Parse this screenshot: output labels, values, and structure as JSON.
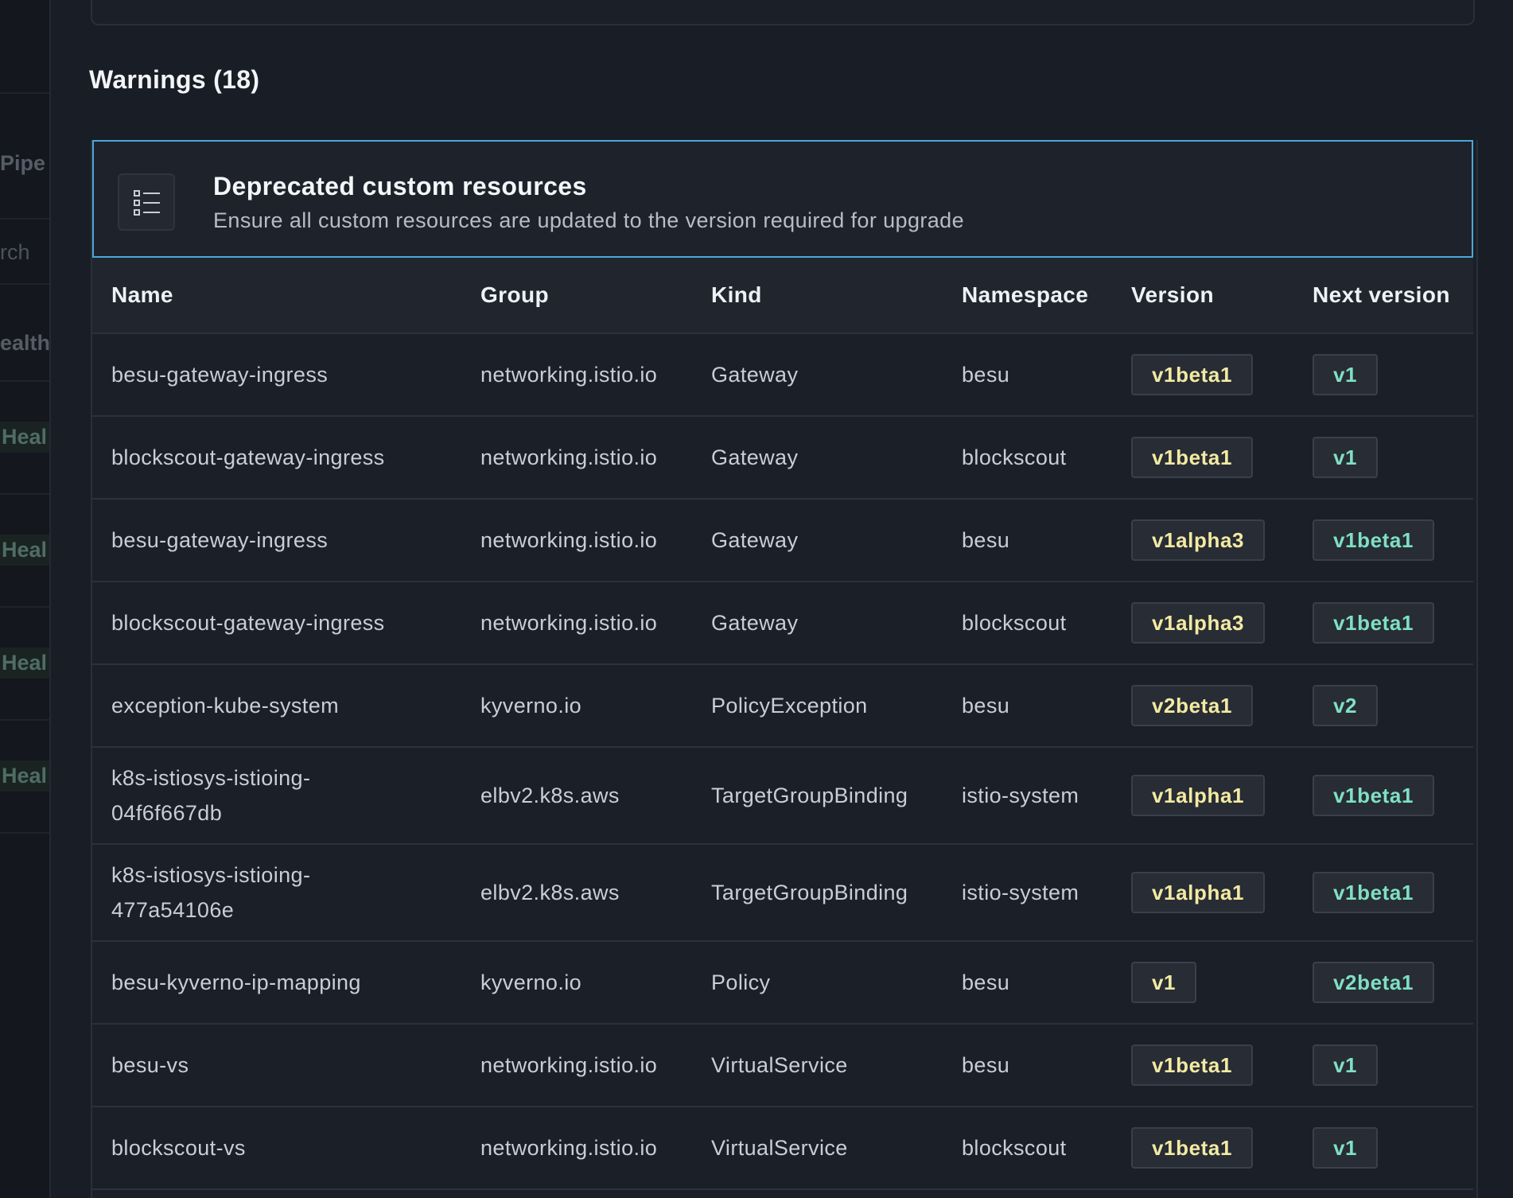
{
  "sidebar": {
    "items": [
      {
        "label": "Pipe",
        "kind": "bold"
      },
      {
        "label": "rch",
        "kind": "plain"
      },
      {
        "label": "ealth",
        "kind": "bold"
      },
      {
        "label": "Heal",
        "kind": "health"
      },
      {
        "label": "Heal",
        "kind": "health"
      },
      {
        "label": "Heal",
        "kind": "health"
      },
      {
        "label": "Heal",
        "kind": "health"
      }
    ]
  },
  "section": {
    "title": "Warnings (18)"
  },
  "card": {
    "icon": "list-icon",
    "title": "Deprecated custom resources",
    "subtitle": "Ensure all custom resources are updated to the version required for upgrade",
    "collapse_icon": "chevron-up-icon"
  },
  "table": {
    "headers": {
      "name": "Name",
      "group": "Group",
      "kind": "Kind",
      "namespace": "Namespace",
      "version": "Version",
      "next_version": "Next version"
    },
    "rows": [
      {
        "name": "besu-gateway-ingress",
        "group": "networking.istio.io",
        "kind": "Gateway",
        "namespace": "besu",
        "version": "v1beta1",
        "next_version": "v1"
      },
      {
        "name": "blockscout-gateway-ingress",
        "group": "networking.istio.io",
        "kind": "Gateway",
        "namespace": "blockscout",
        "version": "v1beta1",
        "next_version": "v1"
      },
      {
        "name": "besu-gateway-ingress",
        "group": "networking.istio.io",
        "kind": "Gateway",
        "namespace": "besu",
        "version": "v1alpha3",
        "next_version": "v1beta1"
      },
      {
        "name": "blockscout-gateway-ingress",
        "group": "networking.istio.io",
        "kind": "Gateway",
        "namespace": "blockscout",
        "version": "v1alpha3",
        "next_version": "v1beta1"
      },
      {
        "name": "exception-kube-system",
        "group": "kyverno.io",
        "kind": "PolicyException",
        "namespace": "besu",
        "version": "v2beta1",
        "next_version": "v2"
      },
      {
        "name_lines": [
          "k8s-istiosys-istioing-",
          "04f6f667db"
        ],
        "group": "elbv2.k8s.aws",
        "kind": "TargetGroupBinding",
        "namespace": "istio-system",
        "version": "v1alpha1",
        "next_version": "v1beta1"
      },
      {
        "name_lines": [
          "k8s-istiosys-istioing-",
          "477a54106e"
        ],
        "group": "elbv2.k8s.aws",
        "kind": "TargetGroupBinding",
        "namespace": "istio-system",
        "version": "v1alpha1",
        "next_version": "v1beta1"
      },
      {
        "name": "besu-kyverno-ip-mapping",
        "group": "kyverno.io",
        "kind": "Policy",
        "namespace": "besu",
        "version": "v1",
        "next_version": "v2beta1"
      },
      {
        "name": "besu-vs",
        "group": "networking.istio.io",
        "kind": "VirtualService",
        "namespace": "besu",
        "version": "v1beta1",
        "next_version": "v1"
      },
      {
        "name": "blockscout-vs",
        "group": "networking.istio.io",
        "kind": "VirtualService",
        "namespace": "blockscout",
        "version": "v1beta1",
        "next_version": "v1"
      }
    ]
  },
  "colors": {
    "accent_border": "#4aa8d8",
    "version_text": "#f3eaa2",
    "next_version_text": "#7fe0c4"
  }
}
